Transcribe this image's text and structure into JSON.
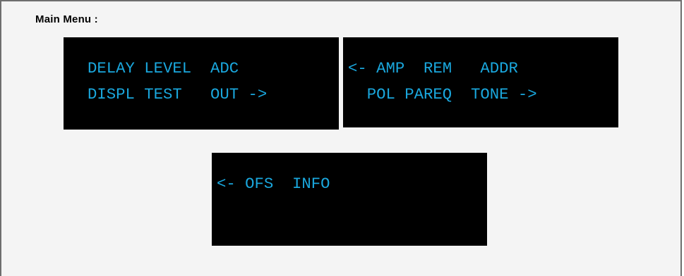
{
  "title": "Main Menu :",
  "screens": [
    {
      "line1": "DELAY LEVEL  ADC",
      "line2": "DISPL TEST   OUT ->"
    },
    {
      "line1": "<- AMP  REM   ADDR",
      "line2": "  POL PAREQ  TONE ->"
    },
    {
      "line1": "<- OFS  INFO",
      "line2": ""
    }
  ],
  "colors": {
    "lcd_background": "#000000",
    "lcd_text": "#1aa7dd",
    "frame_border": "#6e6e6e",
    "frame_background": "#f4f4f4"
  }
}
